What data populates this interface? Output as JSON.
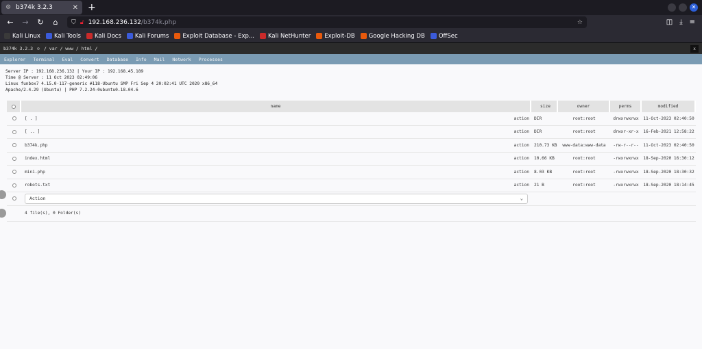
{
  "browser": {
    "tab_title": "b374k 3.2.3",
    "url_host": "192.168.236.132",
    "url_path": "/b374k.php",
    "bookmarks": [
      {
        "label": "Kali Linux",
        "color": "#3a3a3a"
      },
      {
        "label": "Kali Tools",
        "color": "#3b5bdb"
      },
      {
        "label": "Kali Docs",
        "color": "#c92a2a"
      },
      {
        "label": "Kali Forums",
        "color": "#3b5bdb"
      },
      {
        "label": "Exploit Database - Exp...",
        "color": "#e8590c"
      },
      {
        "label": "Kali NetHunter",
        "color": "#c92a2a"
      },
      {
        "label": "Exploit-DB",
        "color": "#e8590c"
      },
      {
        "label": "Google Hacking DB",
        "color": "#e8590c"
      },
      {
        "label": "OffSec",
        "color": "#3b5bdb"
      }
    ]
  },
  "app": {
    "title": "b374k 3.2.3",
    "path": "/ var / www / html /",
    "close_label": "x",
    "menu": [
      "Explorer",
      "Terminal",
      "Eval",
      "Convert",
      "Database",
      "Info",
      "Mail",
      "Network",
      "Processes"
    ]
  },
  "info": {
    "line1": "Server IP : 192.168.236.132 | Your IP : 192.168.45.189",
    "line2": "Time @ Server : 11 Oct 2023 02:49:06",
    "line3": "Linux funbox7 4.15.0-117-generic #118-Ubuntu SMP Fri Sep 4 20:02:41 UTC 2020 x86_64",
    "line4": "Apache/2.4.29 (Ubuntu) | PHP 7.2.24-0ubuntu0.18.04.6"
  },
  "table": {
    "headers": {
      "name": "name",
      "size": "size",
      "owner": "owner",
      "perms": "perms",
      "modified": "modified"
    },
    "rows": [
      {
        "name": "[ . ]",
        "action": "action",
        "size": "DIR",
        "owner": "root:root",
        "perms": "drwxrwxrwx",
        "modified": "11-Oct-2023 02:40:50"
      },
      {
        "name": "[ .. ]",
        "action": "action",
        "size": "DIR",
        "owner": "root:root",
        "perms": "drwxr-xr-x",
        "modified": "16-Feb-2021 12:58:22"
      },
      {
        "name": "b374k.php",
        "action": "action",
        "size": "210.73 KB",
        "owner": "www-data:www-data",
        "perms": "-rw-r--r--",
        "modified": "11-Oct-2023 02:40:50"
      },
      {
        "name": "index.html",
        "action": "action",
        "size": "10.66 KB",
        "owner": "root:root",
        "perms": "-rwxrwxrwx",
        "modified": "18-Sep-2020 16:30:12"
      },
      {
        "name": "mini.php",
        "action": "action",
        "size": "8.03 KB",
        "owner": "root:root",
        "perms": "-rwxrwxrwx",
        "modified": "18-Sep-2020 18:30:32"
      },
      {
        "name": "robots.txt",
        "action": "action",
        "size": "21 B",
        "owner": "root:root",
        "perms": "-rwxrwxrwx",
        "modified": "18-Sep-2020 18:14:45"
      }
    ],
    "action_select": "Action",
    "summary": "4 file(s), 0 Folder(s)"
  }
}
